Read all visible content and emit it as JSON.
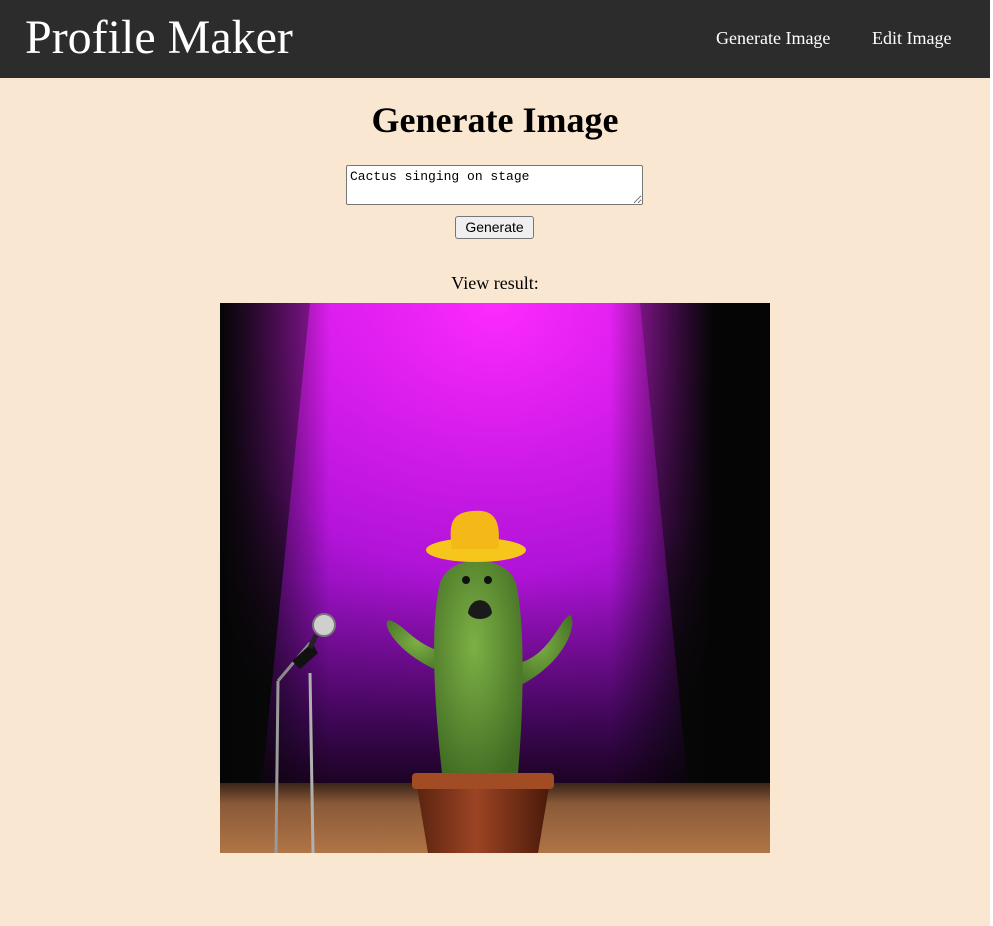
{
  "navbar": {
    "brand": "Profile Maker",
    "links": [
      {
        "label": "Generate Image"
      },
      {
        "label": "Edit Image"
      }
    ]
  },
  "main": {
    "heading": "Generate Image",
    "prompt": {
      "value": "Cactus singing on stage"
    },
    "generate_label": "Generate",
    "result_label": "View result:",
    "result_image": {
      "subject": "cactus with yellow cowboy hat singing at a microphone under a magenta spotlight"
    }
  },
  "colors": {
    "navbar_bg": "#2c2c2c",
    "page_bg": "#f9e7d1",
    "nav_text": "#ffffff",
    "spotlight": "#f01bf5",
    "cactus": "#5a8a2e",
    "hat": "#f7c61c",
    "pot": "#8a3a1f"
  }
}
